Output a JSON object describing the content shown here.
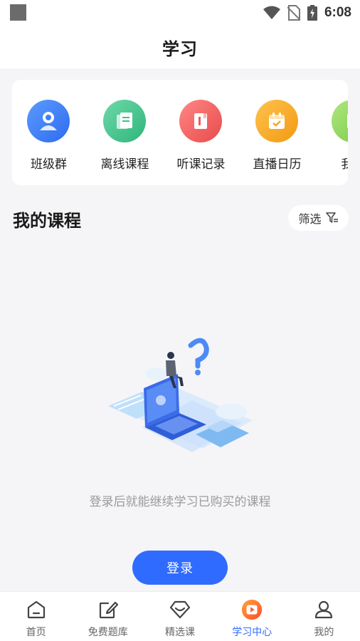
{
  "status_bar": {
    "time": "6:08"
  },
  "header": {
    "title": "学习"
  },
  "shortcuts": [
    {
      "label": "班级群",
      "icon": "class-group-icon",
      "color": "#3a7bf0"
    },
    {
      "label": "离线课程",
      "icon": "offline-course-icon",
      "color": "#3fc28a"
    },
    {
      "label": "听课记录",
      "icon": "listen-record-icon",
      "color": "#ef5a5a"
    },
    {
      "label": "直播日历",
      "icon": "live-calendar-icon",
      "color": "#f5a623"
    },
    {
      "label": "我的",
      "icon": "my-icon",
      "color": "#8bd65a"
    }
  ],
  "section": {
    "title": "我的课程",
    "filter_label": "筛选"
  },
  "empty_state": {
    "message": "登录后就能继续学习已购买的课程",
    "login_label": "登录"
  },
  "bottom_nav": [
    {
      "label": "首页",
      "icon": "home-icon",
      "active": false
    },
    {
      "label": "免费题库",
      "icon": "question-bank-icon",
      "active": false
    },
    {
      "label": "精选课",
      "icon": "featured-course-icon",
      "active": false
    },
    {
      "label": "学习中心",
      "icon": "study-center-icon",
      "active": true
    },
    {
      "label": "我的",
      "icon": "profile-icon",
      "active": false
    }
  ],
  "colors": {
    "accent": "#2f6bff",
    "background": "#f5f5f7"
  }
}
